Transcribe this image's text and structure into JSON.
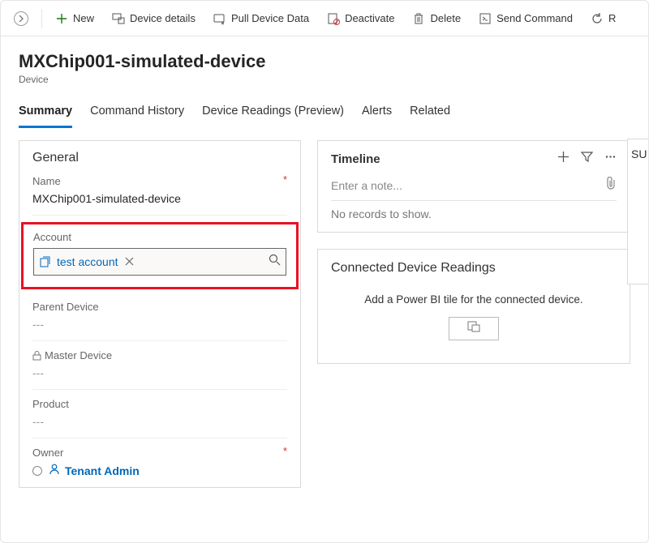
{
  "toolbar": {
    "new_label": "New",
    "device_details_label": "Device details",
    "pull_data_label": "Pull Device Data",
    "deactivate_label": "Deactivate",
    "delete_label": "Delete",
    "send_command_label": "Send Command",
    "refresh_partial": "R"
  },
  "header": {
    "title": "MXChip001-simulated-device",
    "subtitle": "Device"
  },
  "tabs": {
    "summary": "Summary",
    "command_history": "Command History",
    "device_readings": "Device Readings (Preview)",
    "alerts": "Alerts",
    "related": "Related"
  },
  "general": {
    "title": "General",
    "name_label": "Name",
    "name_value": "MXChip001-simulated-device",
    "account_label": "Account",
    "account_value": "test account",
    "parent_label": "Parent Device",
    "parent_value": "---",
    "master_label": "Master Device",
    "master_value": "---",
    "product_label": "Product",
    "product_value": "---",
    "owner_label": "Owner",
    "owner_value": "Tenant Admin"
  },
  "timeline": {
    "title": "Timeline",
    "placeholder": "Enter a note...",
    "empty": "No records to show."
  },
  "connected": {
    "title": "Connected Device Readings",
    "body": "Add a Power BI tile for the connected device."
  },
  "peek": {
    "text": "SU"
  }
}
